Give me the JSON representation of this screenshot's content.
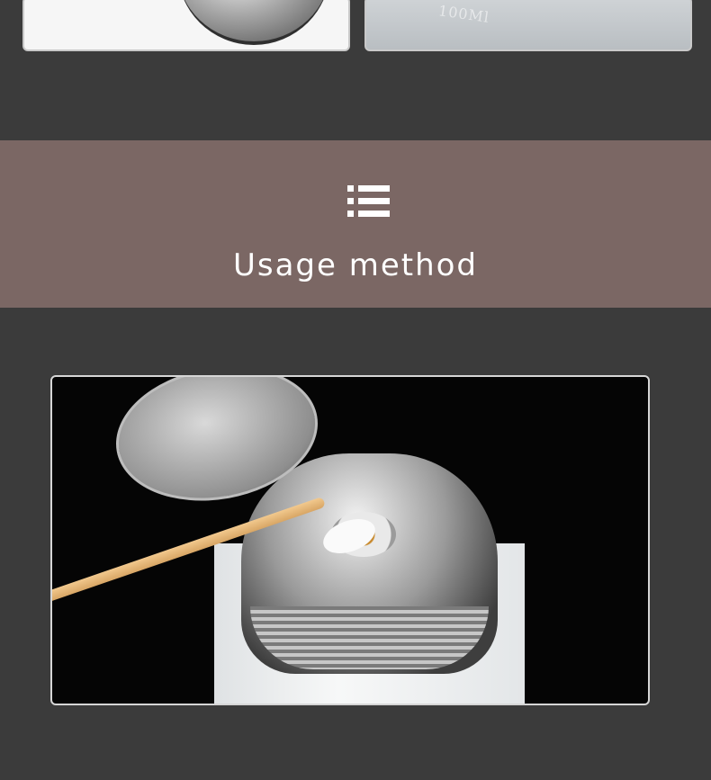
{
  "top_photos": [
    {
      "name": "bottle-cap-closeup",
      "engraving": ""
    },
    {
      "name": "bottle-measurement",
      "engraving": "100Ml"
    }
  ],
  "banner": {
    "icon": "list-icon",
    "title": "Usage method",
    "background": "#7b6764"
  },
  "usage_photo": {
    "icon": "pump-bottle-with-cotton-swab"
  },
  "page": {
    "background": "#3b3b3b"
  }
}
